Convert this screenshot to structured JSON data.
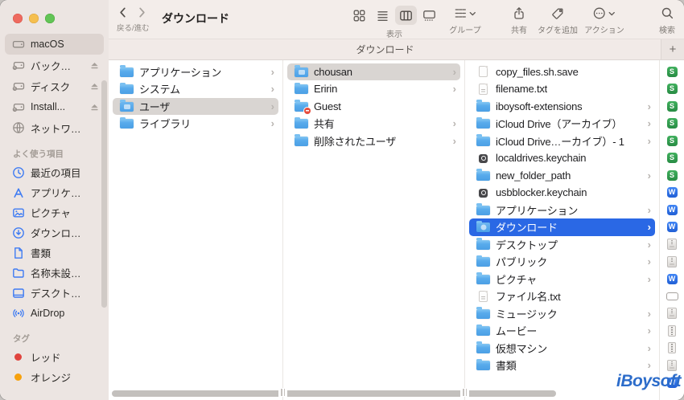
{
  "toolbar": {
    "back_forward_label": "戻る/進む",
    "title": "ダウンロード",
    "view_switcher_label": "表示",
    "buttons": {
      "group": "グループ",
      "share": "共有",
      "add_tag": "タグを追加",
      "action": "アクション",
      "search": "検索"
    }
  },
  "tab_bar": {
    "active_tab": "ダウンロード",
    "new_tab_button": "+"
  },
  "sidebar": {
    "devices": [
      {
        "label": "macOS",
        "icon": "internal-drive-icon",
        "selected": true,
        "ejectable": false
      },
      {
        "label": "バック…",
        "icon": "external-drive-icon",
        "selected": false,
        "ejectable": true
      },
      {
        "label": "ディスク",
        "icon": "external-drive-icon",
        "selected": false,
        "ejectable": true
      },
      {
        "label": "Install...",
        "icon": "external-drive-icon",
        "selected": false,
        "ejectable": true
      },
      {
        "label": "ネットワ…",
        "icon": "network-icon",
        "selected": false,
        "ejectable": false
      }
    ],
    "favorites_header": "よく使う項目",
    "favorites": [
      {
        "label": "最近の項目",
        "icon": "clock-icon"
      },
      {
        "label": "アプリケ…",
        "icon": "applications-icon"
      },
      {
        "label": "ピクチャ",
        "icon": "pictures-icon"
      },
      {
        "label": "ダウンロ…",
        "icon": "download-icon"
      },
      {
        "label": "書類",
        "icon": "document-icon"
      },
      {
        "label": "名称未設…",
        "icon": "folder-icon"
      },
      {
        "label": "デスクト…",
        "icon": "desktop-icon"
      },
      {
        "label": "AirDrop",
        "icon": "airdrop-icon"
      }
    ],
    "tags_header": "タグ",
    "tags": [
      {
        "label": "レッド",
        "color": "#e0443e"
      },
      {
        "label": "オレンジ",
        "color": "#f7a10d"
      }
    ]
  },
  "finder_columns": {
    "columns": [
      {
        "name": "locations",
        "items": [
          {
            "label": "アプリケーション",
            "icon": "folder",
            "chevron": true
          },
          {
            "label": "システム",
            "icon": "folder",
            "chevron": true
          },
          {
            "label": "ユーザ",
            "icon": "folder-open",
            "chevron": true,
            "selected": "gray"
          },
          {
            "label": "ライブラリ",
            "icon": "folder",
            "chevron": true
          }
        ]
      },
      {
        "name": "users",
        "items": [
          {
            "label": "chousan",
            "icon": "folder-home",
            "chevron": true,
            "selected": "gray"
          },
          {
            "label": "Eririn",
            "icon": "folder",
            "chevron": true
          },
          {
            "label": "Guest",
            "icon": "folder-minus",
            "chevron": false
          },
          {
            "label": "共有",
            "icon": "folder",
            "chevron": true
          },
          {
            "label": "削除されたユーザ",
            "icon": "folder",
            "chevron": true
          }
        ]
      },
      {
        "name": "home",
        "items": [
          {
            "label": "copy_files.sh.save",
            "icon": "doc",
            "chevron": false
          },
          {
            "label": "filename.txt",
            "icon": "doc-text",
            "chevron": false
          },
          {
            "label": "iboysoft-extensions",
            "icon": "folder",
            "chevron": true
          },
          {
            "label": "iCloud Drive（アーカイブ）",
            "icon": "folder",
            "chevron": true
          },
          {
            "label": "iCloud Drive…ーカイブ）- 1",
            "icon": "folder",
            "chevron": true
          },
          {
            "label": "localdrives.keychain",
            "icon": "keychain",
            "chevron": false
          },
          {
            "label": "new_folder_path",
            "icon": "folder",
            "chevron": true
          },
          {
            "label": "usbblocker.keychain",
            "icon": "keychain",
            "chevron": false
          },
          {
            "label": "アプリケーション",
            "icon": "folder",
            "chevron": true
          },
          {
            "label": "ダウンロード",
            "icon": "folder-download",
            "chevron": true,
            "selected": "blue"
          },
          {
            "label": "デスクトップ",
            "icon": "folder",
            "chevron": true
          },
          {
            "label": "パブリック",
            "icon": "folder",
            "chevron": true
          },
          {
            "label": "ピクチャ",
            "icon": "folder",
            "chevron": true
          },
          {
            "label": "ファイル名.txt",
            "icon": "doc-text",
            "chevron": false
          },
          {
            "label": "ミュージック",
            "icon": "folder",
            "chevron": true
          },
          {
            "label": "ムービー",
            "icon": "folder",
            "chevron": true
          },
          {
            "label": "仮想マシン",
            "icon": "folder",
            "chevron": true
          },
          {
            "label": "書類",
            "icon": "folder",
            "chevron": true
          }
        ]
      },
      {
        "name": "downloads-preview",
        "icons_only": true,
        "icons": [
          "app-s",
          "app-s",
          "app-s",
          "app-s",
          "app-s",
          "app-s",
          "app-s",
          "app-w",
          "app-w",
          "app-w",
          "archive",
          "archive",
          "app-w",
          "disk-image",
          "archive",
          "zip-doc",
          "zip-doc",
          "archive",
          "app-w"
        ]
      }
    ]
  },
  "app_badges": {
    "app-s": "S",
    "app-w": "W"
  },
  "watermark": {
    "text": "iBoysoft"
  },
  "colors": {
    "selection_blue": "#2a68e5",
    "selection_gray": "#d9d5d2",
    "folder_blue": "#58abec",
    "sidebar_bg": "#ece5e2",
    "toolbar_bg": "#f3edea",
    "tag_red": "#e0443e",
    "tag_orange": "#f7a10d",
    "badge_green": "#2f9e4e",
    "badge_blue": "#2563eb",
    "watermark_blue": "#2c6cca"
  }
}
